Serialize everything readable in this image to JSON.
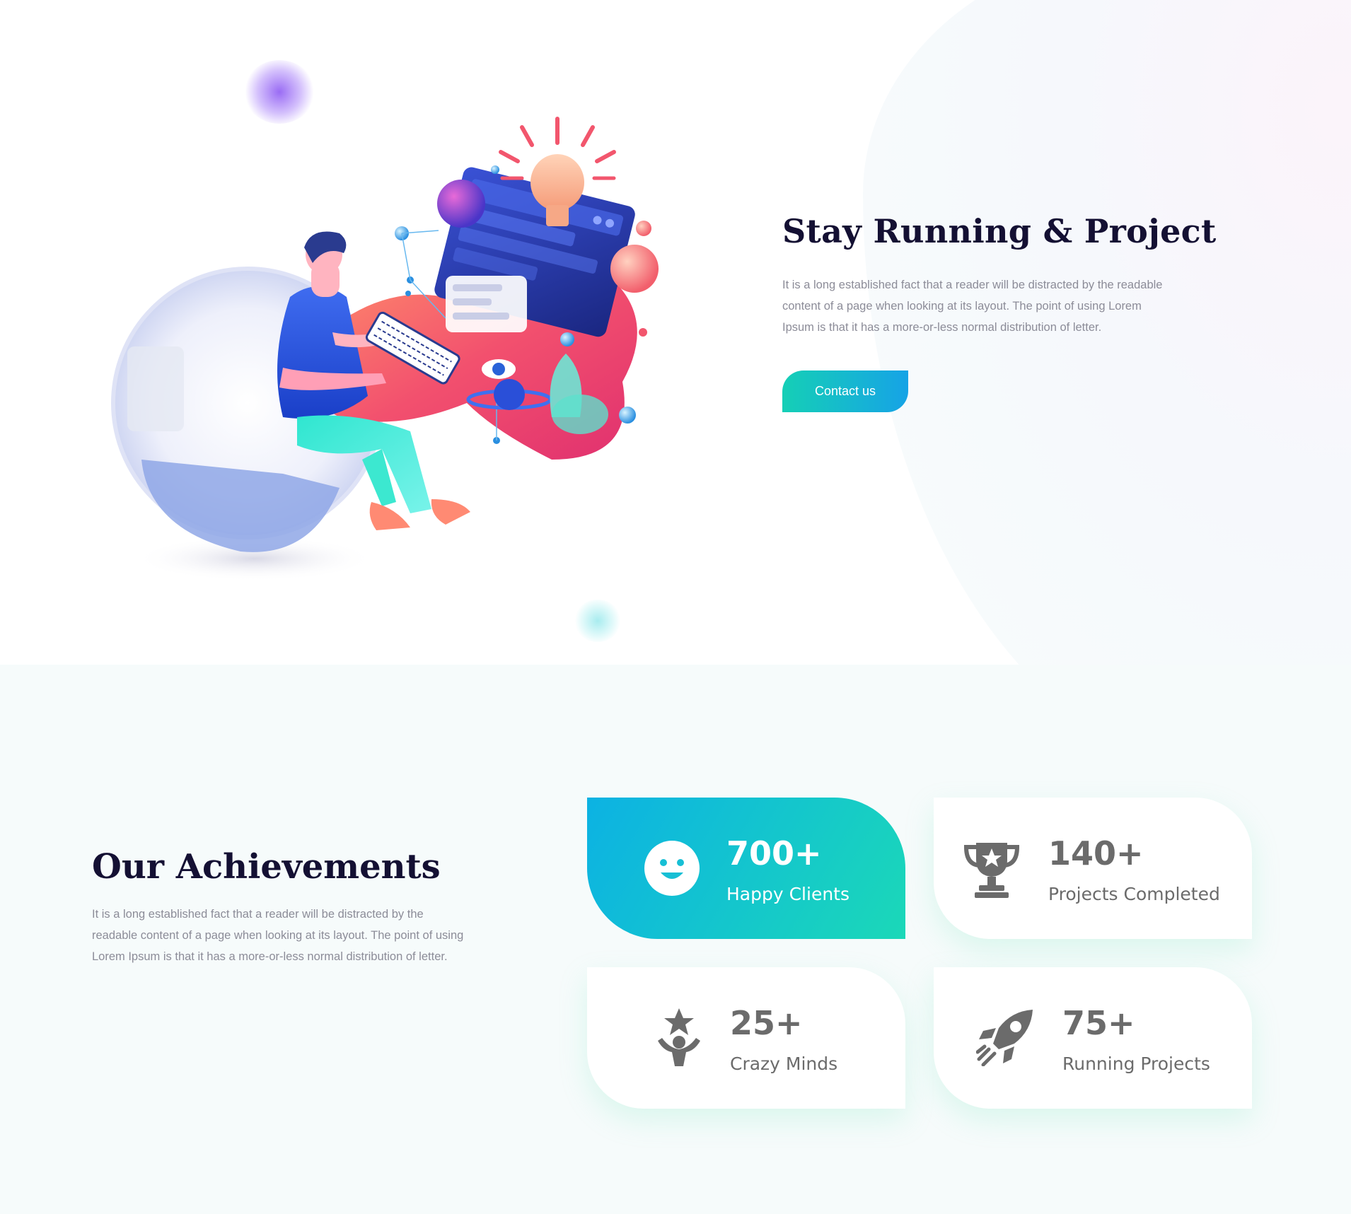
{
  "hero": {
    "title": "Stay Running & Project",
    "body": "It is a long established fact that a reader will be distracted by the readable content of a page when looking at its layout. The point of using Lorem Ipsum is that it has a more-or-less normal distribution of letter.",
    "cta_label": "Contact us"
  },
  "achievements": {
    "title": "Our Achievements",
    "body": "It is a long established fact that a reader will be distracted by the readable content of a page when looking at its layout. The point of using Lorem Ipsum is that it has a more-or-less normal distribution of letter.",
    "stats": [
      {
        "value": "700+",
        "label": "Happy Clients",
        "icon": "smiley-icon"
      },
      {
        "value": "140+",
        "label": "Projects Completed",
        "icon": "trophy-icon"
      },
      {
        "value": "25+",
        "label": "Crazy Minds",
        "icon": "person-star-icon"
      },
      {
        "value": "75+",
        "label": "Running Projects",
        "icon": "rocket-icon"
      }
    ]
  },
  "colors": {
    "heading": "#141033",
    "body_text": "#8c8c98",
    "accent_start": "#15cfb6",
    "accent_end": "#16a3e6",
    "stat_text": "#6b6b6b",
    "section_bg": "#f6fbfb"
  }
}
